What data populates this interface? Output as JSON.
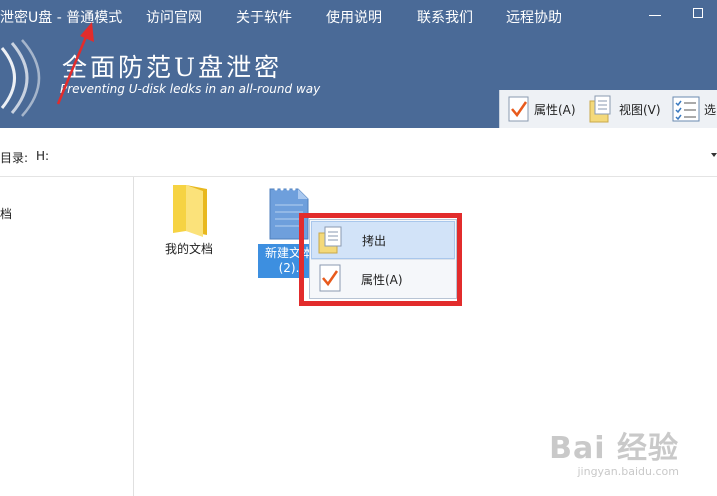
{
  "window": {
    "title": "泄密U盘 - 普通模式",
    "menu": [
      "访问官网",
      "关于软件",
      "使用说明",
      "联系我们",
      "远程协助"
    ]
  },
  "banner": {
    "slogan": "全面防范U盘泄密",
    "slogan_en": "Preventing U-disk ledks in an all-round way"
  },
  "toolbar": {
    "properties_label": "属性(A)",
    "view_label": "视图(V)",
    "select_label": "选"
  },
  "pathbar": {
    "label": "目录:",
    "value": "H:"
  },
  "tree": {
    "item": "档"
  },
  "files": [
    {
      "name": "我的文档",
      "type": "folder",
      "selected": false
    },
    {
      "name_line1": "新建文本",
      "name_line2": "(2).",
      "type": "document",
      "selected": true
    }
  ],
  "context_menu": {
    "items": [
      {
        "label": "拷出",
        "icon": "copy-out-icon",
        "active": true
      },
      {
        "label": "属性(A)",
        "icon": "checkmark-properties-icon",
        "active": false
      }
    ]
  },
  "colors": {
    "header_bg": "#4a6a97",
    "highlight_red": "#e22c2c",
    "selection_blue": "#3d8fe0"
  },
  "watermark": {
    "main": "Bai 经验",
    "sub": "jingyan.baidu.com"
  }
}
